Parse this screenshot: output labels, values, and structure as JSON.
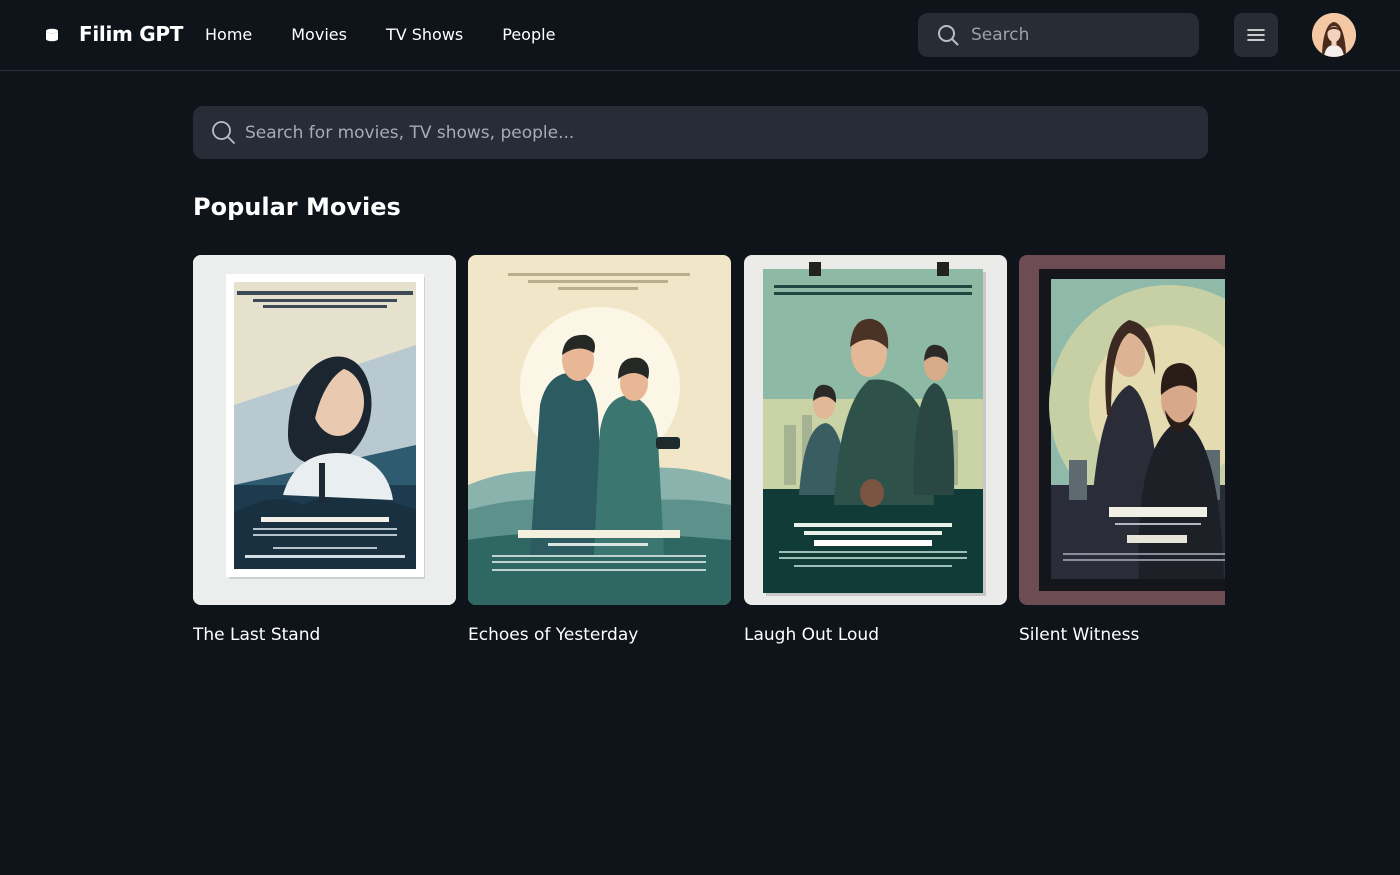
{
  "brand": {
    "name": "Filim GPT",
    "logo_icon": "database-icon"
  },
  "nav": {
    "items": [
      {
        "label": "Home"
      },
      {
        "label": "Movies"
      },
      {
        "label": "TV Shows"
      },
      {
        "label": "People"
      }
    ]
  },
  "top_search": {
    "placeholder": "Search",
    "icon": "search-icon"
  },
  "menu_button": {
    "icon": "hamburger-menu-icon"
  },
  "avatar": {
    "icon": "user-avatar"
  },
  "main_search": {
    "placeholder": "Search for movies, TV shows, people...",
    "icon": "search-icon"
  },
  "section": {
    "title": "Popular Movies",
    "movies": [
      {
        "title": "The Last Stand"
      },
      {
        "title": "Echoes of Yesterday"
      },
      {
        "title": "Laugh Out Loud"
      },
      {
        "title": "Silent Witness"
      }
    ]
  },
  "colors": {
    "background": "#0f131a",
    "surface": "#272c35",
    "text": "#ffffff",
    "muted": "#9ba1ab"
  }
}
